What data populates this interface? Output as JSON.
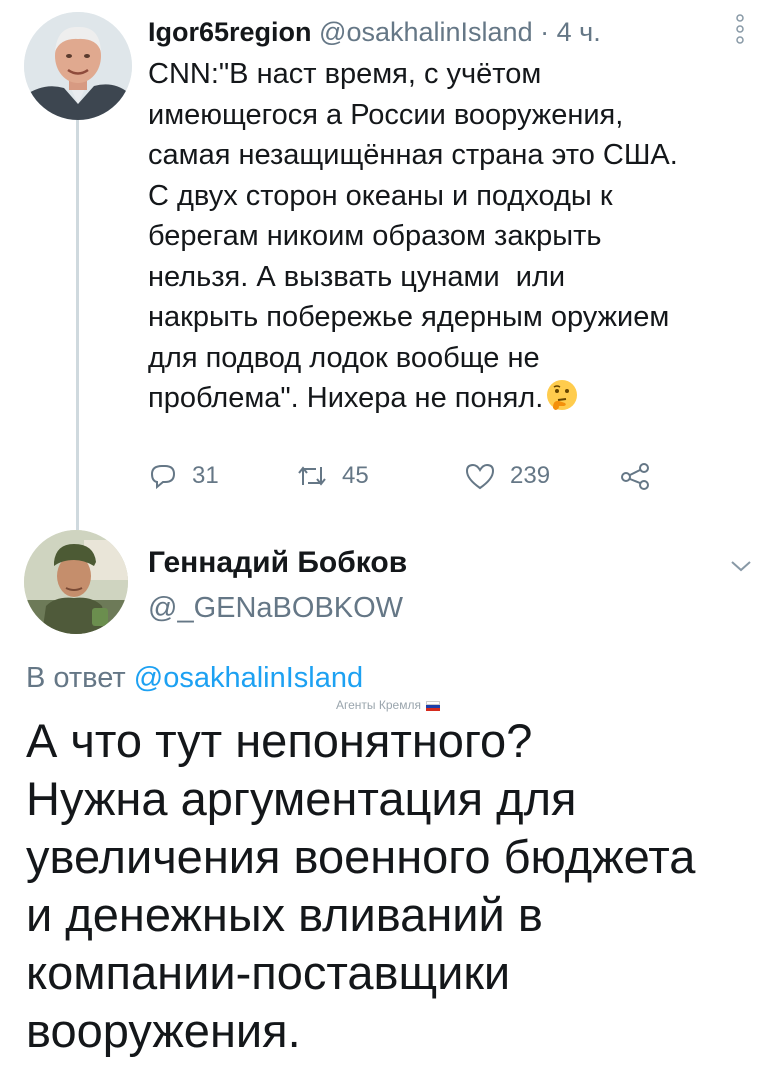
{
  "tweet1": {
    "display_name": "Igor65region",
    "handle": "@osakhalinIsland",
    "separator": "·",
    "time": "4 ч.",
    "text_lines": [
      "CNN:\"В наст время, с учётом",
      "имеющегося а России вооружения,",
      "самая незащищённая страна это США.",
      "С двух сторон океаны и подходы к",
      "берегам никоим образом закрыть",
      "нельзя. А вызвать цунами  или",
      "накрыть побережье ядерным оружием",
      "для подвод лодок вообще не",
      "проблема\". Нихера не понял."
    ],
    "emoji": "thinking-face-emoji",
    "actions": {
      "replies": "31",
      "retweets": "45",
      "likes": "239"
    }
  },
  "tweet2": {
    "display_name": "Геннадий Бобков",
    "handle": "@_GENaBOBKOW",
    "reply_prefix": "В ответ ",
    "reply_to": "@osakhalinIsland",
    "watermark": "Агенты Кремля",
    "text_lines": [
      "А что тут непонятного?",
      "Нужна аргументация для",
      "увеличения военного бюджета",
      "и денежных вливаний в",
      "компании-поставщики",
      "вооружения."
    ]
  },
  "colors": {
    "text": "#14171a",
    "secondary": "#657786",
    "link": "#1da1f2",
    "thread_line": "#cfd9de"
  },
  "icons": [
    "more-vertical-icon",
    "reply-icon",
    "retweet-icon",
    "like-icon",
    "share-icon",
    "chevron-down-icon",
    "russian-flag-icon"
  ]
}
